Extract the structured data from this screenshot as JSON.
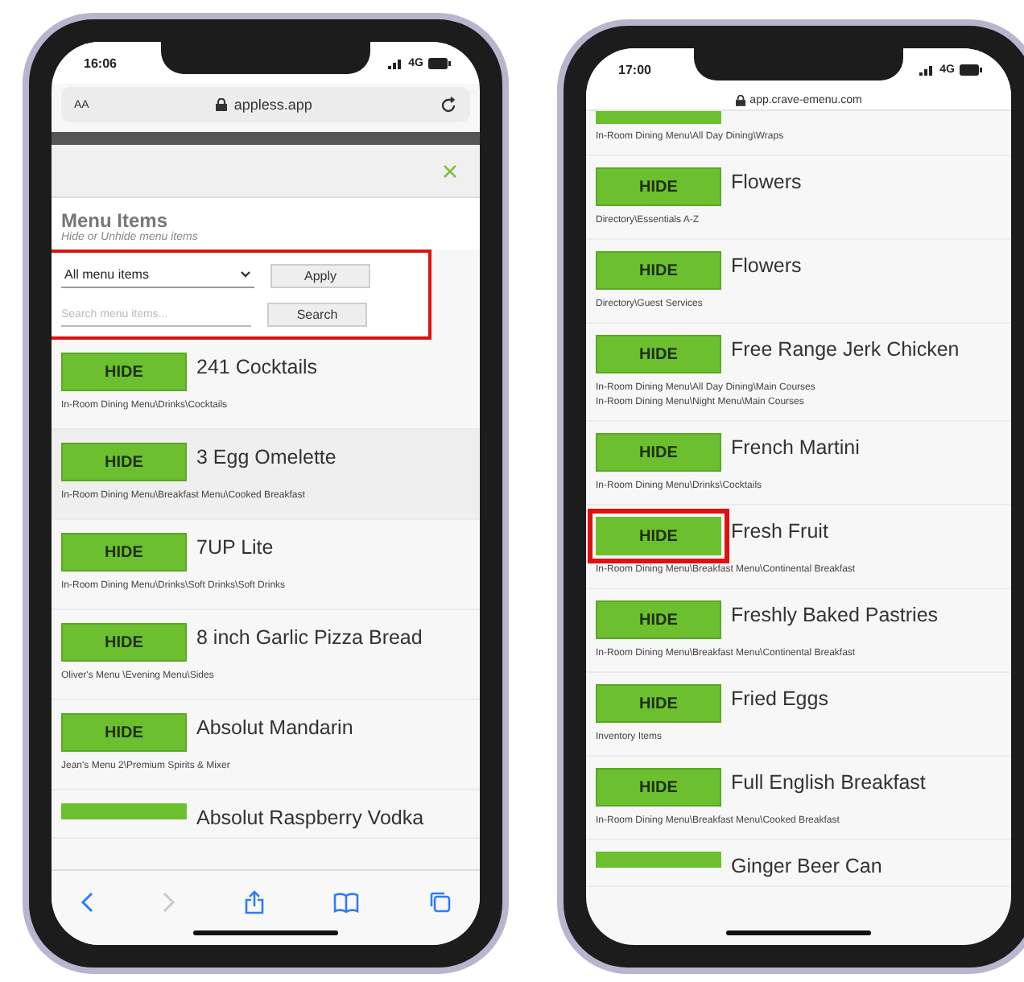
{
  "phones": [
    {
      "status_bar": {
        "time": "16:06",
        "network": "4G"
      },
      "address_bar": {
        "kind": "full",
        "text_size": "AA",
        "url": "appless.app"
      },
      "panel": {
        "title": "Menu Items",
        "subtitle": "Hide or Unhide menu items",
        "filter": {
          "highlighted": true,
          "select": "All menu items",
          "apply": "Apply",
          "search_placeholder": "Search menu items...",
          "search": "Search"
        }
      },
      "items": [
        {
          "kind": "full",
          "button": "HIDE",
          "name": "241 Cocktails",
          "paths": [
            "In-Room Dining Menu\\Drinks\\Cocktails"
          ],
          "highlighted": false
        },
        {
          "kind": "full",
          "button": "HIDE",
          "name": "3 Egg Omelette",
          "paths": [
            "In-Room Dining Menu\\Breakfast Menu\\Cooked Breakfast"
          ],
          "highlighted": false
        },
        {
          "kind": "full",
          "button": "HIDE",
          "name": "7UP Lite",
          "paths": [
            "In-Room Dining Menu\\Drinks\\Soft Drinks\\Soft Drinks"
          ],
          "highlighted": false
        },
        {
          "kind": "full",
          "button": "HIDE",
          "name": "8 inch Garlic Pizza Bread",
          "paths": [
            "Oliver's Menu \\Evening Menu\\Sides"
          ],
          "highlighted": false
        },
        {
          "kind": "full",
          "button": "HIDE",
          "name": "Absolut Mandarin",
          "paths": [
            "Jean's Menu 2\\Premium Spirits & Mixer"
          ],
          "highlighted": false
        },
        {
          "kind": "cut-bottom",
          "name": "Absolut Raspberry Vodka",
          "highlighted": false
        }
      ],
      "toolbar": true
    },
    {
      "status_bar": {
        "time": "17:00",
        "network": "4G"
      },
      "address_bar": {
        "kind": "compact",
        "url": "app.crave-emenu.com"
      },
      "items": [
        {
          "kind": "cut-top",
          "paths": [
            "In-Room Dining Menu\\All Day Dining\\Wraps"
          ],
          "highlighted": false
        },
        {
          "kind": "full",
          "button": "HIDE",
          "name": "Flowers",
          "paths": [
            "Directory\\Essentials A-Z"
          ],
          "highlighted": false
        },
        {
          "kind": "full",
          "button": "HIDE",
          "name": "Flowers",
          "paths": [
            "Directory\\Guest Services"
          ],
          "highlighted": false
        },
        {
          "kind": "full",
          "button": "HIDE",
          "name": "Free Range Jerk Chicken",
          "paths": [
            "In-Room Dining Menu\\All Day Dining\\Main Courses",
            "In-Room Dining Menu\\Night Menu\\Main Courses"
          ],
          "highlighted": false
        },
        {
          "kind": "full",
          "button": "HIDE",
          "name": "French Martini",
          "paths": [
            "In-Room Dining Menu\\Drinks\\Cocktails"
          ],
          "highlighted": false
        },
        {
          "kind": "full",
          "button": "HIDE",
          "name": "Fresh Fruit",
          "paths": [
            "In-Room Dining Menu\\Breakfast Menu\\Continental Breakfast"
          ],
          "highlighted": true
        },
        {
          "kind": "full",
          "button": "HIDE",
          "name": "Freshly Baked Pastries",
          "paths": [
            "In-Room Dining Menu\\Breakfast Menu\\Continental Breakfast"
          ],
          "highlighted": false
        },
        {
          "kind": "full",
          "button": "HIDE",
          "name": "Fried Eggs",
          "paths": [
            "Inventory Items"
          ],
          "highlighted": false
        },
        {
          "kind": "full",
          "button": "HIDE",
          "name": "Full English Breakfast",
          "paths": [
            "In-Room Dining Menu\\Breakfast Menu\\Cooked Breakfast"
          ],
          "highlighted": false
        },
        {
          "kind": "cut-bottom",
          "name": "Ginger Beer Can",
          "highlighted": false
        }
      ],
      "toolbar": false
    }
  ]
}
